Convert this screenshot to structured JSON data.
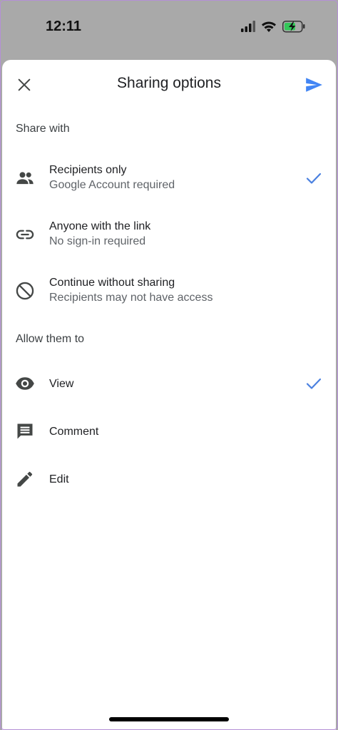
{
  "status_bar": {
    "time": "12:11"
  },
  "header": {
    "title": "Sharing options",
    "close_icon": "close-icon",
    "send_icon": "send-icon"
  },
  "share_with": {
    "label": "Share with",
    "options": [
      {
        "title": "Recipients only",
        "subtitle": "Google Account required",
        "icon": "people-icon",
        "selected": true
      },
      {
        "title": "Anyone with the link",
        "subtitle": "No sign-in required",
        "icon": "link-icon",
        "selected": false
      },
      {
        "title": "Continue without sharing",
        "subtitle": "Recipients may not have access",
        "icon": "block-icon",
        "selected": false
      }
    ]
  },
  "allow_them_to": {
    "label": "Allow them to",
    "options": [
      {
        "title": "View",
        "icon": "eye-icon",
        "selected": true
      },
      {
        "title": "Comment",
        "icon": "comment-icon",
        "selected": false
      },
      {
        "title": "Edit",
        "icon": "pencil-icon",
        "selected": false
      }
    ]
  },
  "colors": {
    "accent": "#4285f4",
    "check": "#4a80e0",
    "icon": "#444746",
    "status_bar_bg": "#a9a9a9",
    "battery_green": "#34c759"
  }
}
